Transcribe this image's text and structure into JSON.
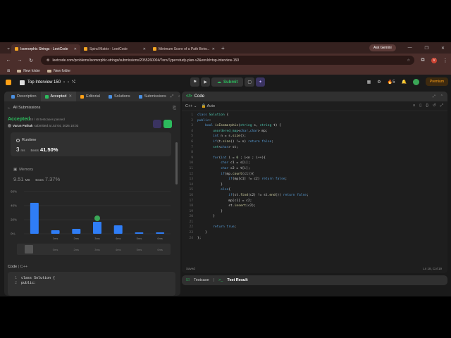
{
  "browser": {
    "tabs": [
      {
        "title": "Isomorphic Strings - LeetCode",
        "active": true
      },
      {
        "title": "Spiral Matrix - LeetCode",
        "active": false
      },
      {
        "title": "Minimum Score of a Path Betw...",
        "active": false
      }
    ],
    "ask_gemini": "Ask Gemini",
    "url": "leetcode.com/problems/isomorphic-strings/submissions/2055260004/?envType=study-plan-v2&envId=top-interview-150",
    "bookmarks": [
      "New folder",
      "New folder"
    ],
    "avatar_letter": "V"
  },
  "header": {
    "study_plan": "Top Interview 150",
    "submit_label": "Submit",
    "streak": "5",
    "premium_label": "Premium"
  },
  "left": {
    "tabs": [
      "Description",
      "Accepted",
      "Editorial",
      "Solutions",
      "Submissions"
    ],
    "all_submissions": "All Submissions",
    "status": "Accepted",
    "testcases": "48 / 48 testcases passed",
    "author": "Varun Pathak",
    "submitted_at": "submitted at Jul 04, 2026 10:03",
    "runtime_label": "Runtime",
    "runtime_value": "3",
    "runtime_unit": "ms",
    "runtime_beats_label": "Beats",
    "runtime_beats": "41.50%",
    "memory_label": "Memory",
    "memory_value": "9.51",
    "memory_unit": "MB",
    "memory_beats_label": "Beats",
    "memory_beats": "7.37%",
    "code_label": "Code",
    "code_lang": "C++",
    "code_preview": [
      {
        "n": "1",
        "t": "class Solution {"
      },
      {
        "n": "2",
        "t": "public:"
      }
    ]
  },
  "chart_data": {
    "type": "bar",
    "categories": [
      "0ms",
      "1ms",
      "2ms",
      "3ms",
      "4ms",
      "5ms",
      "6ms"
    ],
    "values": [
      44,
      5,
      7,
      17,
      12,
      2,
      2
    ],
    "ylim": [
      0,
      60
    ],
    "yticks": [
      "60%",
      "40%",
      "20%",
      "0%"
    ],
    "xtick_labels": [
      "1ms",
      "2ms",
      "3ms",
      "4ms",
      "5ms",
      "6ms"
    ],
    "selected": "3ms",
    "range_labels": [
      "0ms",
      "2ms",
      "3ms",
      "4ms",
      "5ms",
      "6ms"
    ],
    "colors": {
      "bar": "#2f7df6",
      "selected_marker": "#3aa757"
    }
  },
  "editor": {
    "title": "Code",
    "lang": "C++",
    "mode": "Auto",
    "lines": [
      "class Solution {",
      "public:",
      "    bool isIsomorphic(string s, string t) {",
      "        unordered_map<char,char> mp;",
      "        int n = s.size();",
      "        if(t.size() != n) return false;",
      "        set<char> st;",
      "",
      "        for(int i = 0 ; i<n ; i++){",
      "            char c1 = s[i];",
      "            char c2 = t[i];",
      "            if(mp.count(c1)){",
      "                if(mp[c1] != c2) return false;",
      "            }",
      "            else{",
      "                if(st.find(c2) != st.end()) return false;",
      "                mp[c1] = c2;",
      "                st.insert(c2);",
      "            }",
      "        }",
      "",
      "        return true;",
      "    }",
      "};"
    ],
    "saved": "Saved",
    "position": "Ln 18, Col 19"
  },
  "bottom": {
    "testcase": "Testcase",
    "test_result": "Test Result"
  }
}
